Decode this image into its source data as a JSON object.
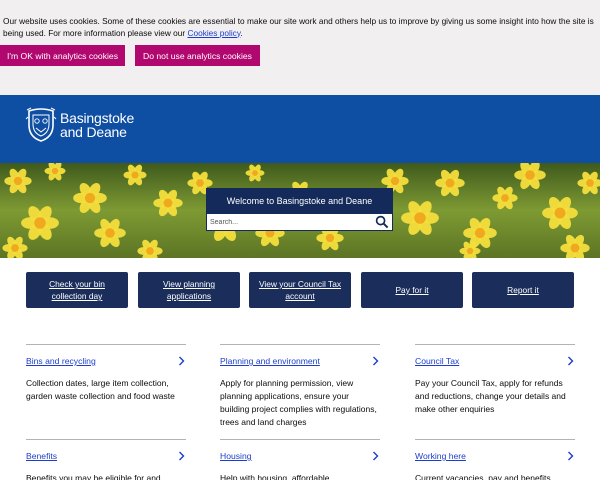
{
  "cookie_banner": {
    "text": "Our website uses cookies. Some of these cookies are essential to make our site work and others help us to improve by giving us some insight into how the site is being used. For more information please view our ",
    "policy_link": "Cookies policy",
    "text_end": ".",
    "accept_label": "I'm OK with analytics cookies",
    "reject_label": "Do not use analytics cookies"
  },
  "header": {
    "logo_line1": "Basingstoke",
    "logo_line2": "and Deane"
  },
  "hero": {
    "welcome": "Welcome to Basingstoke and Deane",
    "search_placeholder": "Search..."
  },
  "quick_links": [
    {
      "line1": "Check your bin",
      "line2": "collection day"
    },
    {
      "line1": "View planning",
      "line2": "applications"
    },
    {
      "line1": "View your Council Tax",
      "line2": "account"
    },
    {
      "line1": "Pay for it",
      "line2": ""
    },
    {
      "line1": "Report it",
      "line2": ""
    }
  ],
  "services": [
    {
      "title": "Bins and recycling",
      "desc": "Collection dates, large item collection, garden waste collection and food waste"
    },
    {
      "title": "Planning and environment",
      "desc": "Apply for planning permission, view planning applications, ensure your building project complies with regulations, trees and land charges"
    },
    {
      "title": "Council Tax",
      "desc": "Pay your Council Tax, apply for refunds and reductions, change your details and make other enquiries"
    },
    {
      "title": "Benefits",
      "desc": "Benefits you may be eligible for and"
    },
    {
      "title": "Housing",
      "desc": "Help with housing, affordable"
    },
    {
      "title": "Working here",
      "desc": "Current vacancies, pay and benefits"
    }
  ],
  "colors": {
    "cookie_bg": "#f1efef",
    "cookie_button": "#b0086f",
    "header": "#0f4fa3",
    "navy": "#1b2d5a",
    "link": "#1d3dcc"
  },
  "icons": [
    "council-crest-icon",
    "search-icon",
    "chevron-right-icon"
  ]
}
